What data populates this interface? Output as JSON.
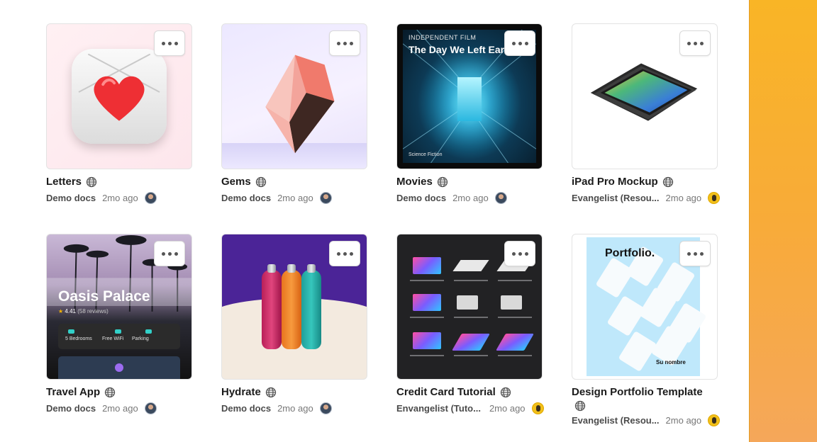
{
  "colors": {
    "panel_accent": "#f9b526",
    "avatar_bot": "#f2c01a"
  },
  "icons": {
    "more": "more-horizontal-icon",
    "visibility": "globe-icon"
  },
  "cards": [
    {
      "title": "Letters",
      "source": "Demo docs",
      "time": "2mo ago",
      "avatar": "person"
    },
    {
      "title": "Gems",
      "source": "Demo docs",
      "time": "2mo ago",
      "avatar": "person"
    },
    {
      "title": "Movies",
      "source": "Demo docs",
      "time": "2mo ago",
      "avatar": "person",
      "thumb": {
        "kicker": "INDEPENDENT FILM",
        "headline": "The Day We Left Ear",
        "footer": "Science Fiction"
      }
    },
    {
      "title": "iPad Pro Mockup",
      "source": "Evangelist (Resou...",
      "time": "2mo ago",
      "avatar": "bot"
    },
    {
      "title": "Travel App",
      "source": "Demo docs",
      "time": "2mo ago",
      "avatar": "person",
      "thumb": {
        "headline": "Oasis Palace",
        "rating": "4.41",
        "reviews": "(58 reviews)",
        "amenities": [
          "5 Bedrooms",
          "Free WiFi",
          "Parking"
        ]
      }
    },
    {
      "title": "Hydrate",
      "source": "Demo docs",
      "time": "2mo ago",
      "avatar": "person"
    },
    {
      "title": "Credit Card Tutorial",
      "source": "Envangelist (Tuto...",
      "time": "2mo ago",
      "avatar": "bot"
    },
    {
      "title": "Design Portfolio Template",
      "source": "Evangelist (Resou...",
      "time": "2mo ago",
      "avatar": "bot",
      "thumb": {
        "headline": "Portfolio.",
        "name": "Su nombre"
      }
    }
  ]
}
